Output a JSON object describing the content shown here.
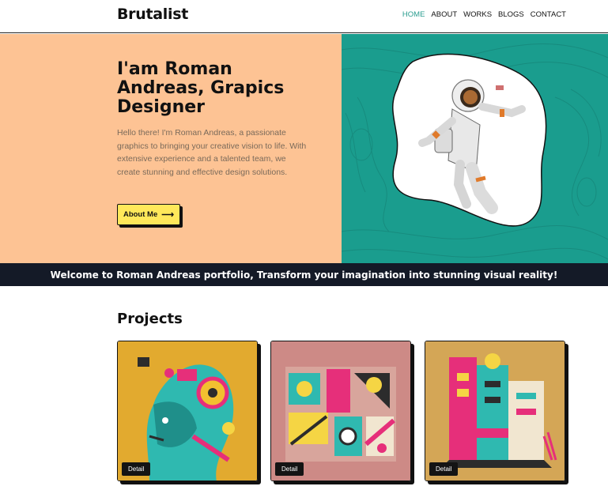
{
  "header": {
    "brand": "Brutalist",
    "nav": [
      "HOME",
      "ABOUT",
      "WORKS",
      "BLOGS",
      "CONTACT"
    ],
    "active": "HOME"
  },
  "hero": {
    "title": "I'am Roman Andreas, Grapics Designer",
    "description": "Hello there! I'm Roman Andreas, a passionate graphics to bringing your creative vision to life. With extensive experience and a talented team, we create stunning and effective design solutions.",
    "button_label": "About Me",
    "button_icon": "arrow-right-icon",
    "left_bg": "#fdc394",
    "right_bg": "#1a9d8e"
  },
  "marquee": {
    "text": "Welcome to Roman Andreas portfolio, Transform your imagination into stunning visual reality!"
  },
  "projects": {
    "title": "Projects",
    "cards": [
      {
        "bg": "#e2aa2f",
        "detail_label": "Detail"
      },
      {
        "bg": "#cd8a86",
        "detail_label": "Detail"
      },
      {
        "bg": "#d4a656",
        "detail_label": "Detail"
      }
    ]
  }
}
